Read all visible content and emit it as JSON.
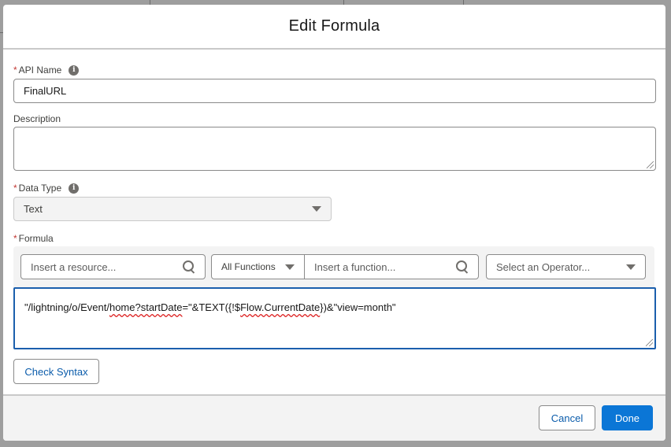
{
  "modal": {
    "title": "Edit Formula"
  },
  "fields": {
    "api_name": {
      "required_marker": "*",
      "label": "API Name",
      "info_icon": "info-icon",
      "value": "FinalURL"
    },
    "description": {
      "label": "Description",
      "value": ""
    },
    "data_type": {
      "required_marker": "*",
      "label": "Data Type",
      "info_icon": "info-icon",
      "value": "Text",
      "disabled": true
    },
    "formula": {
      "required_marker": "*",
      "label": "Formula",
      "value_parts": [
        "\"/lightning/o/Event/",
        "home?startDate",
        "=\"&TEXT({!$",
        "Flow.CurrentDate",
        "})&\"view=month\""
      ]
    }
  },
  "formula_toolbar": {
    "resource_placeholder": "Insert a resource...",
    "functions_filter": "All Functions",
    "function_placeholder": "Insert a function...",
    "operator_placeholder": "Select an Operator..."
  },
  "buttons": {
    "check_syntax": "Check Syntax",
    "cancel": "Cancel",
    "done": "Done"
  },
  "colors": {
    "brand": "#0b76d6",
    "focus_border": "#1b5fad",
    "required": "#c23934"
  }
}
